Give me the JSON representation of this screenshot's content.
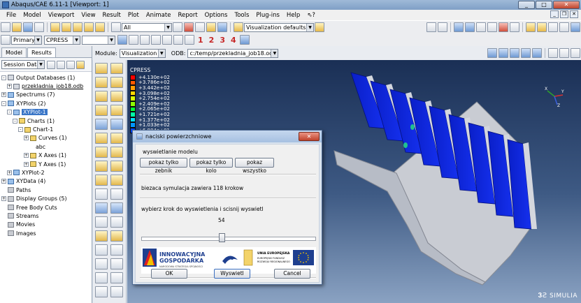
{
  "window": {
    "title": "Abaqus/CAE 6.11-1 [Viewport: 1]"
  },
  "menu": [
    "File",
    "Model",
    "Viewport",
    "View",
    "Result",
    "Plot",
    "Animate",
    "Report",
    "Options",
    "Tools",
    "Plug-ins",
    "Help",
    "⇖?"
  ],
  "toolbar": {
    "selection_filter": "All",
    "render_style": "Visualization defaults",
    "primary_label": "Primary",
    "variable": "CPRESS",
    "numbers": [
      "1",
      "2",
      "3",
      "4"
    ]
  },
  "context": {
    "module_label": "Module:",
    "module_value": "Visualization",
    "odb_label": "ODB:",
    "odb_value": "c:/temp/przekladnia_job18.odb"
  },
  "left_panel": {
    "tabs": [
      "Model",
      "Results"
    ],
    "session_label": "Session Data",
    "tree": [
      {
        "label": "Output Databases (1)",
        "indent": 0,
        "exp": "-",
        "icon": "db"
      },
      {
        "label": "przekladnia_job18.odb",
        "indent": 1,
        "exp": "+",
        "icon": "db",
        "style": "ul"
      },
      {
        "label": "Spectrums (7)",
        "indent": 0,
        "exp": "+",
        "icon": "xy"
      },
      {
        "label": "XYPlots (2)",
        "indent": 0,
        "exp": "-",
        "icon": "xy"
      },
      {
        "label": "XYPlot-1",
        "indent": 1,
        "exp": "-",
        "icon": "xy",
        "style": "hl"
      },
      {
        "label": "Charts (1)",
        "indent": 2,
        "exp": "-",
        "icon": "folder"
      },
      {
        "label": "Chart-1",
        "indent": 3,
        "exp": "-",
        "icon": "folder"
      },
      {
        "label": "Curves (1)",
        "indent": 4,
        "exp": "+",
        "icon": "folder"
      },
      {
        "label": "abc",
        "indent": 5,
        "exp": "",
        "icon": ""
      },
      {
        "label": "X Axes (1)",
        "indent": 4,
        "exp": "+",
        "icon": "folder"
      },
      {
        "label": "Y Axes (1)",
        "indent": 4,
        "exp": "+",
        "icon": "folder"
      },
      {
        "label": "XYPlot-2",
        "indent": 1,
        "exp": "+",
        "icon": "xy"
      },
      {
        "label": "XYData (4)",
        "indent": 0,
        "exp": "+",
        "icon": "xy"
      },
      {
        "label": "Paths",
        "indent": 0,
        "exp": "",
        "icon": "gray"
      },
      {
        "label": "Display Groups (5)",
        "indent": 0,
        "exp": "+",
        "icon": "gray"
      },
      {
        "label": "Free Body Cuts",
        "indent": 0,
        "exp": "",
        "icon": "gray"
      },
      {
        "label": "Streams",
        "indent": 0,
        "exp": "",
        "icon": "gray"
      },
      {
        "label": "Movies",
        "indent": 0,
        "exp": "",
        "icon": "gray"
      },
      {
        "label": "Images",
        "indent": 0,
        "exp": "",
        "icon": "gray"
      }
    ]
  },
  "legend": {
    "title": "CPRESS",
    "values": [
      "+4.130e+02",
      "+3.786e+02",
      "+3.442e+02",
      "+3.098e+02",
      "+2.754e+02",
      "+2.409e+02",
      "+2.065e+02",
      "+1.721e+02",
      "+1.377e+02",
      "+1.033e+02",
      "+6.884e+01"
    ],
    "colors": [
      "#ff0000",
      "#ff5a00",
      "#ff9e00",
      "#ffd800",
      "#d8ff00",
      "#8cff00",
      "#00ff38",
      "#00ffa8",
      "#00e0ff",
      "#0096ff",
      "#0046ff"
    ]
  },
  "branding": "SIMULIA",
  "dialog": {
    "title": "naciski powierzchniowe",
    "section_label": "wyswietlanie modelu",
    "buttons": [
      "pokaz tylko zebnik",
      "pokaz tylko kolo",
      "pokaz wszystko"
    ],
    "info": "biezaca symulacja zawiera 118 krokow",
    "prompt": "wybierz krok do wyswietlenia i scisnij wyswietl",
    "slider_value": "54",
    "slider_fraction": 0.46,
    "logos": {
      "ig1": "INNOWACYJNA",
      "ig2": "GOSPODARKA",
      "ig3": "NARODOWA STRATEGIA SPÓJNOŚCI",
      "ue1": "UNIA EUROPEJSKA",
      "ue2": "EUROPEJSKI FUNDUSZ",
      "ue3": "ROZWOJU REGIONALNEGO"
    },
    "ok": "OK",
    "apply": "Wyswietl",
    "cancel": "Cancel"
  }
}
